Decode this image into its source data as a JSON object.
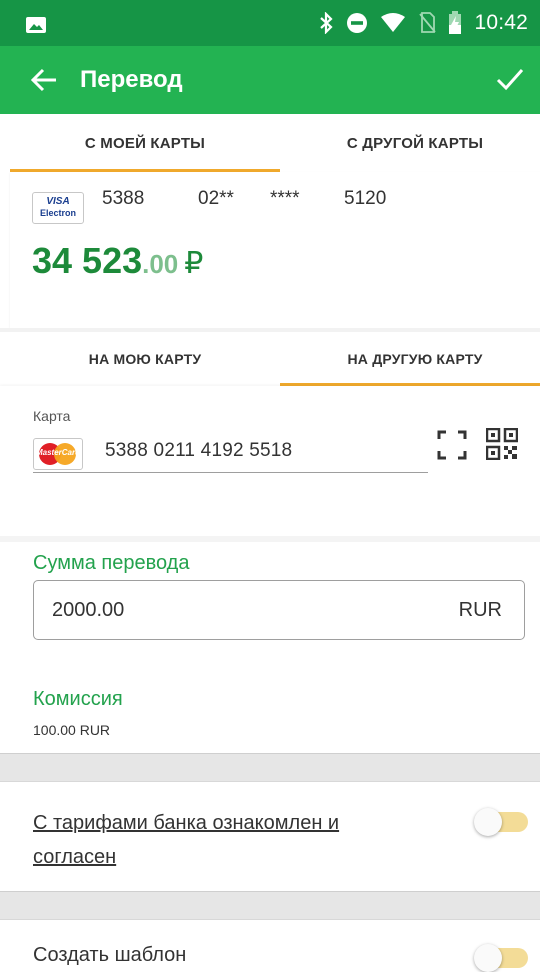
{
  "status_bar": {
    "time": "10:42",
    "icons": [
      "image-icon",
      "bluetooth-icon",
      "do-not-disturb-icon",
      "wifi-icon",
      "no-sim-icon",
      "battery-charging-icon"
    ]
  },
  "app_bar": {
    "title": "Перевод",
    "back_icon": "arrow-left-icon",
    "confirm_icon": "check-icon"
  },
  "source_tabs": [
    {
      "label": "С МОЕЙ КАРТЫ",
      "active": true
    },
    {
      "label": "С ДРУГОЙ КАРТЫ",
      "active": false
    }
  ],
  "source_card": {
    "brand_line1": "VISA",
    "brand_line2": "Electron",
    "number_parts": [
      "5388",
      "02**",
      "****",
      "5120"
    ],
    "balance_int": "34 523",
    "balance_dec": ".00",
    "currency_symbol": "₽"
  },
  "dest_tabs": [
    {
      "label": "НА МОЮ КАРТУ",
      "active": false
    },
    {
      "label": "НА ДРУГУЮ КАРТУ",
      "active": true
    }
  ],
  "dest_card": {
    "label": "Карта",
    "brand": "MasterCard",
    "number": "5388 0211 4192 5518"
  },
  "amount": {
    "title": "Сумма перевода",
    "value": "2000.00",
    "currency": "RUR"
  },
  "fee": {
    "title": "Комиссия",
    "value": "100.00 RUR"
  },
  "agreement": {
    "text": "С тарифами банка ознакомлен и согласен",
    "enabled": false
  },
  "template": {
    "text": "Создать шаблон",
    "enabled": false
  },
  "colors": {
    "status_bar": "#169546",
    "app_bar": "#23b352",
    "accent_tab": "#f0a92c",
    "green_text": "#23a24d",
    "toggle_track": "#f3dc97"
  }
}
